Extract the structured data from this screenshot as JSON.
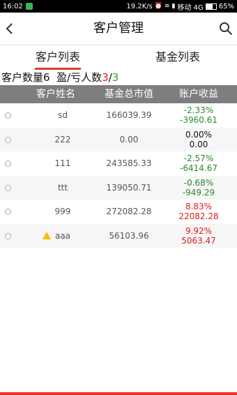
{
  "status_bar": {
    "time": "16:02",
    "speed": "19.2K/s",
    "carrier": "移动 4G",
    "battery": "65%",
    "battery_level": 0.65
  },
  "header": {
    "title": "客户管理",
    "back_icon": "chevron-left-icon",
    "search_icon": "search-icon"
  },
  "tabs": [
    {
      "label": "客户列表",
      "active": true
    },
    {
      "label": "基金列表",
      "active": false
    }
  ],
  "summary": {
    "count_label": "客户数量",
    "count": "6",
    "pl_label": "盈/亏人数",
    "loss_count": "3",
    "separator": "/",
    "gain_count": "3"
  },
  "table": {
    "headers": [
      "客户姓名",
      "基金总市值",
      "账户收益"
    ],
    "rows": [
      {
        "name": "sd",
        "value": "166039.39",
        "pct": "-2.33%",
        "amount": "-3960.61",
        "trend": "down",
        "warning": false
      },
      {
        "name": "222",
        "value": "0.00",
        "pct": "0.00%",
        "amount": "0.00",
        "trend": "flat",
        "warning": false
      },
      {
        "name": "111",
        "value": "243585.33",
        "pct": "-2.57%",
        "amount": "-6414.67",
        "trend": "down",
        "warning": false
      },
      {
        "name": "ttt",
        "value": "139050.71",
        "pct": "-0.68%",
        "amount": "-949.29",
        "trend": "down",
        "warning": false
      },
      {
        "name": "999",
        "value": "272082.28",
        "pct": "8.83%",
        "amount": "22082.28",
        "trend": "up",
        "warning": false
      },
      {
        "name": "aaa",
        "value": "56103.96",
        "pct": "9.92%",
        "amount": "5063.47",
        "trend": "up",
        "warning": true
      }
    ]
  },
  "colors": {
    "up": "#e01b1b",
    "down": "#2a8a2a",
    "flat": "#111111",
    "accent": "#e23b2f",
    "table_header": "#7e7e7e"
  }
}
